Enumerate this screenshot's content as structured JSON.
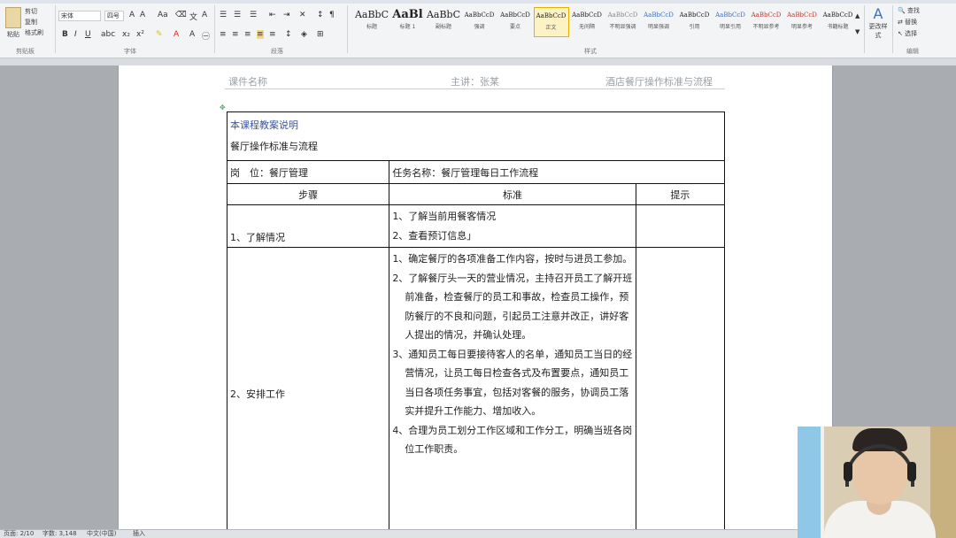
{
  "ribbon": {
    "clipboard": {
      "paste_label": "粘贴",
      "items": [
        "剪切",
        "复制",
        "格式刷"
      ],
      "group_label": "剪贴板"
    },
    "font": {
      "font_name": "宋体",
      "font_size": "四号",
      "group_label": "字体"
    },
    "paragraph": {
      "group_label": "段落"
    },
    "styles": {
      "group_label": "样式",
      "items": [
        {
          "sample": "AaBbC",
          "name": "标题"
        },
        {
          "sample": "AaBl",
          "name": "标题 1"
        },
        {
          "sample": "AaBbC",
          "name": "副标题"
        },
        {
          "sample": "AaBbCcD",
          "name": "强调"
        },
        {
          "sample": "AaBbCcD",
          "name": "要点"
        },
        {
          "sample": "AaBbCcD",
          "name": "正文",
          "active": true
        },
        {
          "sample": "AaBbCcD",
          "name": "无间隔"
        },
        {
          "sample": "AaBbCcD",
          "name": "不明显强调"
        },
        {
          "sample": "AaBbCcD",
          "name": "明显强调"
        },
        {
          "sample": "AaBbCcD",
          "name": "引用"
        },
        {
          "sample": "AaBbCcD",
          "name": "明显引用"
        },
        {
          "sample": "AaBbCcD",
          "name": "不明显参考"
        },
        {
          "sample": "AaBbCcD",
          "name": "明显参考"
        },
        {
          "sample": "AaBbCcD",
          "name": "书籍标题"
        }
      ],
      "change_styles": "更改样式"
    },
    "editing": {
      "group_label": "编辑",
      "items": [
        "查找",
        "替换",
        "选择"
      ]
    }
  },
  "page": {
    "header_left": "课件名称",
    "header_center": "主讲：张某",
    "header_right": "酒店餐厅操作标准与流程",
    "table": {
      "title_line1": "本课程教案说明",
      "title_line2": "餐厅操作标准与流程",
      "post_label": "岗　位：餐厅管理",
      "task_label": "任务名称：餐厅管理每日工作流程",
      "col_headers": [
        "步骤",
        "标准",
        "提示"
      ],
      "rows": [
        {
          "step": "1、了解情况",
          "items": [
            "1、了解当前用餐客情况",
            "2、查看预订信息」"
          ]
        },
        {
          "step": "2、安排工作",
          "items": [
            "1、确定餐厅的各项准备工作内容，按时与进员工参加。",
            "2、了解餐厅头一天的营业情况，主持召开员工了解开班前准备，检查餐厅的员工和事故，检查员工操作，预防餐厅的不良和问题，引起员工注意并改正，讲好客人提出的情况，并确认处理。",
            "3、通知员工每日要接待客人的名单，通知员工当日的经营情况，让员工每日检查各式及布置要点，通知员工当日各项任务事宜，包括对客餐的服务，协调员工落实并提升工作能力、增加收入。",
            "4、合理为员工划分工作区域和工作分工，明确当班各岗位工作职责。"
          ]
        }
      ]
    }
  },
  "status_bar": {
    "page": "页面: 2/10",
    "words": "字数: 3,148",
    "lang": "中文(中国)",
    "mode": "插入"
  }
}
